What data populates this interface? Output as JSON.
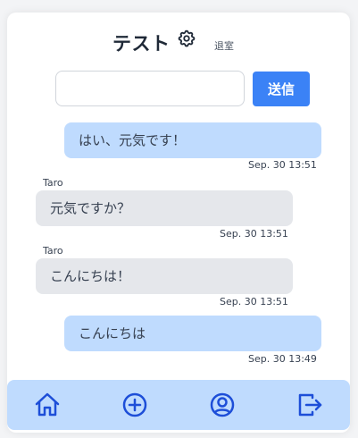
{
  "header": {
    "title": "テスト",
    "settings_icon": "gear-icon",
    "leave_label": "退室"
  },
  "compose": {
    "input_value": "",
    "input_placeholder": "",
    "send_label": "送信"
  },
  "messages": [
    {
      "mine": true,
      "sender": "",
      "text": "はい、元気です！",
      "time": "Sep. 30 13:51"
    },
    {
      "mine": false,
      "sender": "Taro",
      "text": "元気ですか？",
      "time": "Sep. 30 13:51"
    },
    {
      "mine": false,
      "sender": "Taro",
      "text": "こんにちは！",
      "time": "Sep. 30 13:51"
    },
    {
      "mine": true,
      "sender": "",
      "text": "こんにちは",
      "time": "Sep. 30 13:49"
    }
  ],
  "footer": {
    "icons": [
      "home-icon",
      "plus-circle-icon",
      "user-circle-icon",
      "logout-icon"
    ]
  },
  "colors": {
    "accent": "#3b82f6",
    "own_bubble": "#bfdbfe",
    "other_bubble": "#e5e7eb",
    "footer_bg": "#bfdbfe",
    "footer_icon": "#1d4ed8"
  }
}
